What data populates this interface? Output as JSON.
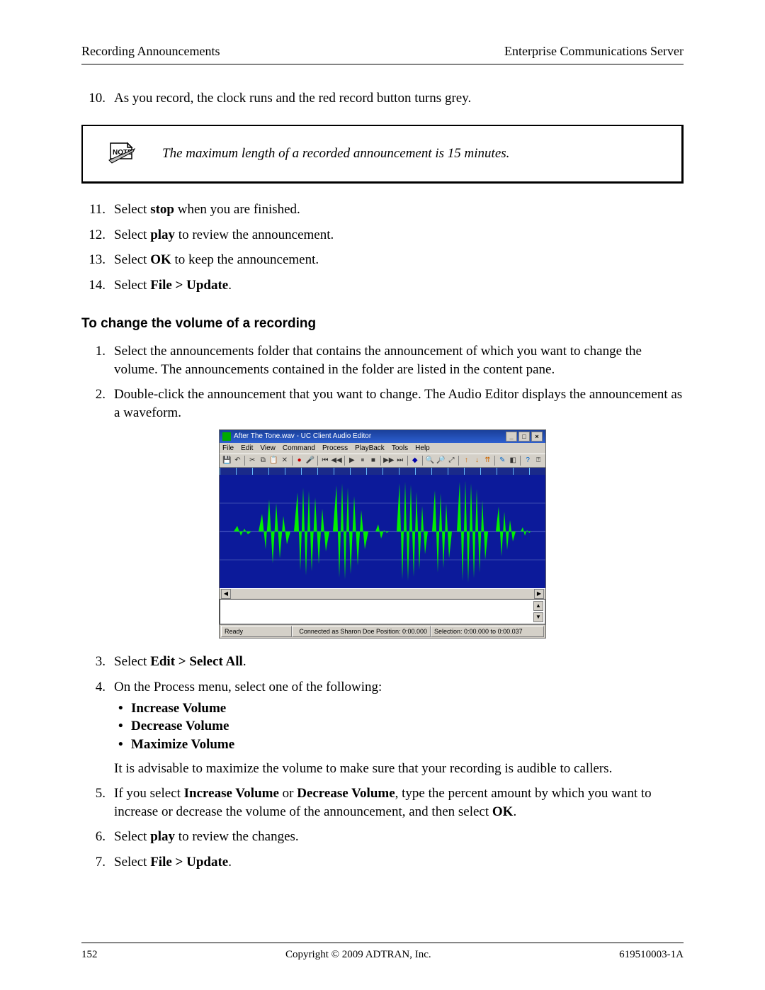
{
  "header": {
    "left": "Recording Announcements",
    "right": "Enterprise Communications Server"
  },
  "body": {
    "step10_num": "10.",
    "step10": "As you record, the clock runs and the red record button turns grey.",
    "note_text": "The maximum length of a recorded announcement is 15 minutes.",
    "step11_num": "11.",
    "step11_a": "Select ",
    "step11_b": "stop",
    "step11_c": " when you are finished.",
    "step12_num": "12.",
    "step12_a": "Select ",
    "step12_b": "play",
    "step12_c": " to review the announcement.",
    "step13_num": "13.",
    "step13_a": "Select ",
    "step13_b": "OK",
    "step13_c": " to keep the announcement.",
    "step14_num": "14.",
    "step14_a": "Select ",
    "step14_b": "File > Update",
    "step14_c": ".",
    "section2_head": "To change the volume of a recording",
    "s2_step1_num": "1.",
    "s2_step1": "Select the announcements folder that contains the announcement of which you want to change the volume. The announcements contained in the folder are listed in the content pane.",
    "s2_step2_num": "2.",
    "s2_step2": "Double-click the announcement that you want to change. The Audio Editor displays the announcement as a waveform.",
    "s2_step3_num": "3.",
    "s2_step3_a": "Select ",
    "s2_step3_b": "Edit > Select All",
    "s2_step3_c": ".",
    "s2_step4_num": "4.",
    "s2_step4": "On the Process menu, select one of the following:",
    "bullets": {
      "b1": "Increase Volume",
      "b2": "Decrease Volume",
      "b3": "Maximize Volume"
    },
    "s2_step4_tail": "It is advisable to maximize the volume to make sure that your recording is audible to callers.",
    "s2_step5_num": "5.",
    "s2_step5_a": "If you select ",
    "s2_step5_b": "Increase Volume",
    "s2_step5_c": " or ",
    "s2_step5_d": "Decrease Volume",
    "s2_step5_e": ", type the percent amount by which you want to increase or decrease the volume of the announcement, and then select ",
    "s2_step5_f": "OK",
    "s2_step5_g": ".",
    "s2_step6_num": "6.",
    "s2_step6_a": "Select ",
    "s2_step6_b": "play",
    "s2_step6_c": " to review the changes.",
    "s2_step7_num": "7.",
    "s2_step7_a": "Select ",
    "s2_step7_b": "File > Update",
    "s2_step7_c": "."
  },
  "audio_editor": {
    "title": "After The Tone.wav - UC Client Audio Editor",
    "menus": [
      "File",
      "Edit",
      "View",
      "Command",
      "Process",
      "PlayBack",
      "Tools",
      "Help"
    ],
    "status_ready": "Ready",
    "status_conn": "Connected as Sharon Doe  Position: 0:00.000",
    "status_sel": "Selection: 0:00.000 to 0:00.037",
    "winbtns": {
      "min": "_",
      "max": "□",
      "close": "×"
    }
  },
  "footer": {
    "page": "152",
    "copyright": "Copyright © 2009 ADTRAN, Inc.",
    "docnum": "619510003-1A"
  }
}
